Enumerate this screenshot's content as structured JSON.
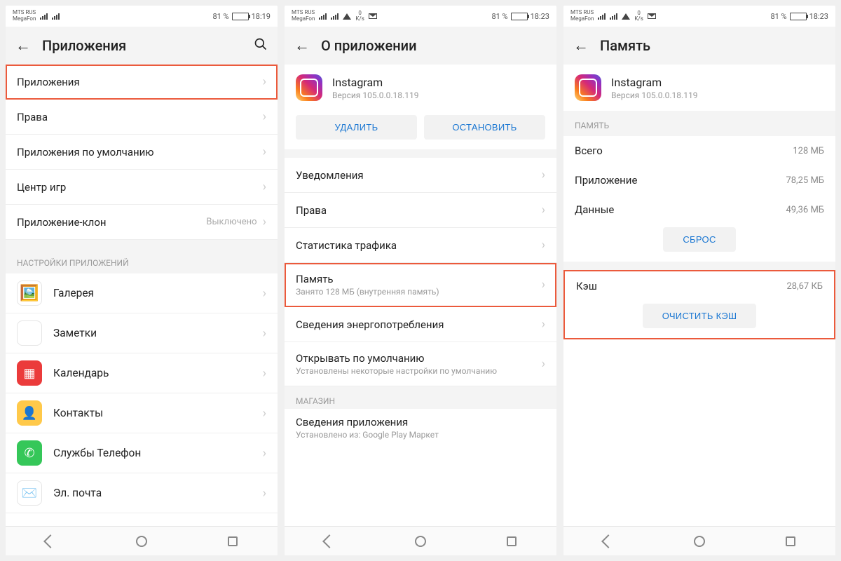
{
  "screens": [
    {
      "status": {
        "carrier1": "MTS RUS",
        "carrier2": "MegaFon",
        "battery": "81 %",
        "battFill": 81,
        "time": "18:19",
        "showWifi": false
      },
      "title": "Приложения",
      "showSearch": true,
      "topRows": [
        {
          "label": "Приложения",
          "highlight": true
        },
        {
          "label": "Права"
        },
        {
          "label": "Приложения по умолчанию"
        },
        {
          "label": "Центр игр"
        },
        {
          "label": "Приложение-клон",
          "value": "Выключено"
        }
      ],
      "sectionHeader": "НАСТРОЙКИ ПРИЛОЖЕНИЙ",
      "appRows": [
        {
          "label": "Галерея",
          "bg": "#ffffff",
          "emoji": "🖼️"
        },
        {
          "label": "Заметки",
          "bg": "#ffffff",
          "emoji": "📄"
        },
        {
          "label": "Календарь",
          "bg": "#ffffff",
          "emoji": "📅"
        },
        {
          "label": "Контакты",
          "bg": "#ffc94a",
          "emoji": "👤"
        },
        {
          "label": "Службы Телефон",
          "bg": "#35c759",
          "emoji": "📞"
        },
        {
          "label": "Эл. почта",
          "bg": "#ffffff",
          "emoji": "✉️"
        }
      ]
    },
    {
      "status": {
        "carrier1": "MTS RUS",
        "carrier2": "MegaFon",
        "battery": "81 %",
        "battFill": 81,
        "time": "18:23",
        "showWifi": true
      },
      "title": "О приложении",
      "showSearch": false,
      "app": {
        "name": "Instagram",
        "version": "Версия 105.0.0.18.119"
      },
      "buttons": {
        "left": "УДАЛИТЬ",
        "right": "ОСТАНОВИТЬ"
      },
      "rows": [
        {
          "label": "Уведомления"
        },
        {
          "label": "Права"
        },
        {
          "label": "Статистика трафика"
        },
        {
          "label": "Память",
          "sub": "Занято 128 МБ (внутренняя память)",
          "highlight": true
        },
        {
          "label": "Сведения энергопотребления"
        },
        {
          "label": "Открывать по умолчанию",
          "sub": "Установлены некоторые настройки по умолчанию"
        }
      ],
      "storeHeader": "МАГАЗИН",
      "store": {
        "label": "Сведения приложения",
        "sub": "Установлено из: Google Play Маркет"
      }
    },
    {
      "status": {
        "carrier1": "MTS RUS",
        "carrier2": "MegaFon",
        "battery": "81 %",
        "battFill": 81,
        "time": "18:23",
        "showWifi": true
      },
      "title": "Память",
      "showSearch": false,
      "app": {
        "name": "Instagram",
        "version": "Версия 105.0.0.18.119"
      },
      "memHeader": "ПАМЯТЬ",
      "memRows": [
        {
          "label": "Всего",
          "value": "128 МБ"
        },
        {
          "label": "Приложение",
          "value": "78,25 МБ"
        },
        {
          "label": "Данные",
          "value": "49,36 МБ"
        }
      ],
      "resetBtn": "СБРОС",
      "cache": {
        "label": "Кэш",
        "value": "28,67 КБ",
        "btn": "ОЧИСТИТЬ КЭШ",
        "highlight": true
      }
    }
  ]
}
